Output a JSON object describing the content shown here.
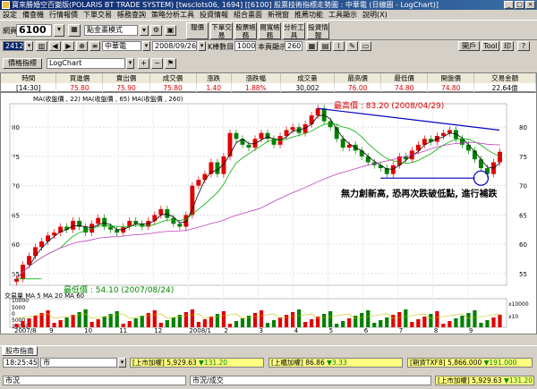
{
  "window": {
    "title": "寶來勝婚空百變版(POLARIS BT TRADE SYSTEM)  [twsclots06, 1694]  [[6100] 股票技術指標走勢圖 : 中華電 (日線圖 - LogChart)]"
  },
  "menu": [
    "設定",
    "備查機",
    "行情報價",
    "下單交易",
    "帳務查詢",
    "策略分析工具",
    "投資情報",
    "組合畫面",
    "新視窗",
    "推薦功能",
    "工具顯示",
    "說明(X)"
  ],
  "toolbar": {
    "page_label": "網頁",
    "page_code": "6100",
    "layout_select": "點金畫模式",
    "buttons": [
      "報價",
      "下單交易",
      "股票帳務",
      "閱寬帳務",
      "分析工具",
      "投資情報"
    ]
  },
  "row2": {
    "stock_code": "2412",
    "stock_name": "中華電",
    "date": "2008/09/26",
    "k_label": "K棒數目",
    "k_count": "1000",
    "display_label": "本頁顯示",
    "display_count": "260",
    "right_buttons": [
      "開戶",
      "Tool",
      "印",
      "?"
    ]
  },
  "row3": {
    "indicator_button": "價格指標",
    "chart_type": "LogChart"
  },
  "quote": {
    "headers": [
      "時間",
      "買進價",
      "賣出價",
      "成交價",
      "漲跌",
      "漲跌幅",
      "成交量",
      "最高價",
      "最低價",
      "開盤價",
      "交易金額"
    ],
    "values": [
      "[14:30]",
      "75.80",
      "75.90",
      "75.80",
      "1.40",
      "1.88%",
      "30,002",
      "76.00",
      "74.80",
      "74.80",
      "22.64億"
    ]
  },
  "chart": {
    "legend_main": "MA(收盤價 , 22)   MA(收盤價 , 65)   MA(收盤價 , 260)",
    "legend_volume": "交易量 MA  5 MA 20 MA 60",
    "annotation_high": "最高價 : 83.20 (2008/04/29)",
    "annotation_low": "最低價 : 54.10 (2007/08/24)",
    "annotation_comment": "無力創新高, 恐再次跌破低點, 進行補跌",
    "colors": {
      "ma22": "#000000",
      "ma65": "#00b000",
      "ma260": "#c040c0",
      "up": "#e00000",
      "down": "#008000",
      "trend": "#0000c0"
    }
  },
  "chart_data": {
    "type": "candlestick",
    "title": "",
    "x_ticks": [
      "2007/8",
      "9",
      "10",
      "11",
      "12",
      "2008/1",
      "2",
      "3",
      "4",
      "5",
      "6",
      "7",
      "8",
      "9"
    ],
    "y_ticks": [
      "55",
      "60",
      "65",
      "70",
      "75",
      "80"
    ],
    "ylim": [
      53,
      84
    ],
    "vol_ticks": [
      "10000",
      "5000",
      "0",
      "5000",
      "10000"
    ],
    "vol_ticks_right": [
      "x10000",
      "x10"
    ],
    "high": {
      "value": 83.2,
      "date": "2008/04/29"
    },
    "low": {
      "value": 54.1,
      "date": "2007/08/24"
    },
    "closes": [
      54.1,
      56.5,
      58.0,
      59.5,
      60.5,
      61.5,
      62.0,
      63.0,
      62.5,
      64.0,
      63.0,
      62.0,
      63.5,
      64.5,
      63.0,
      62.5,
      62.0,
      63.0,
      64.0,
      63.5,
      63.0,
      64.0,
      65.0,
      66.0,
      64.5,
      63.5,
      63.0,
      65.0,
      70.0,
      71.0,
      72.0,
      74.0,
      72.0,
      75.0,
      79.0,
      78.0,
      77.0,
      76.5,
      78.0,
      79.0,
      78.0,
      77.0,
      78.5,
      79.5,
      80.0,
      79.0,
      80.5,
      82.0,
      83.2,
      81.0,
      80.0,
      78.0,
      76.5,
      77.0,
      76.0,
      75.0,
      74.0,
      73.5,
      73.0,
      72.0,
      73.5,
      75.0,
      74.5,
      76.0,
      77.0,
      78.0,
      77.5,
      78.5,
      79.0,
      79.5,
      78.0,
      77.0,
      76.0,
      74.5,
      73.0,
      72.0,
      74.0,
      75.8
    ]
  },
  "status": {
    "tabs": [
      "股市指南"
    ],
    "time": "18:25:45",
    "market_label": "市",
    "tickers": [
      {
        "name": "[上市加權]",
        "price": "5,929.63",
        "arrow": "▼",
        "change": "131.20"
      },
      {
        "name": "[上櫃加權]",
        "price": "86.86",
        "arrow": "▼",
        "change": "3.33"
      },
      {
        "name": "[期貨TXF8]",
        "price": "5,866.000",
        "arrow": "▼",
        "change": "191.000"
      }
    ],
    "bottom_left": "市況",
    "bottom_mid": "市況/成交",
    "bottom_ticker": {
      "name": "[上市加權]",
      "price": "5,929.63",
      "arrow": "▼",
      "change": "131.20"
    }
  }
}
